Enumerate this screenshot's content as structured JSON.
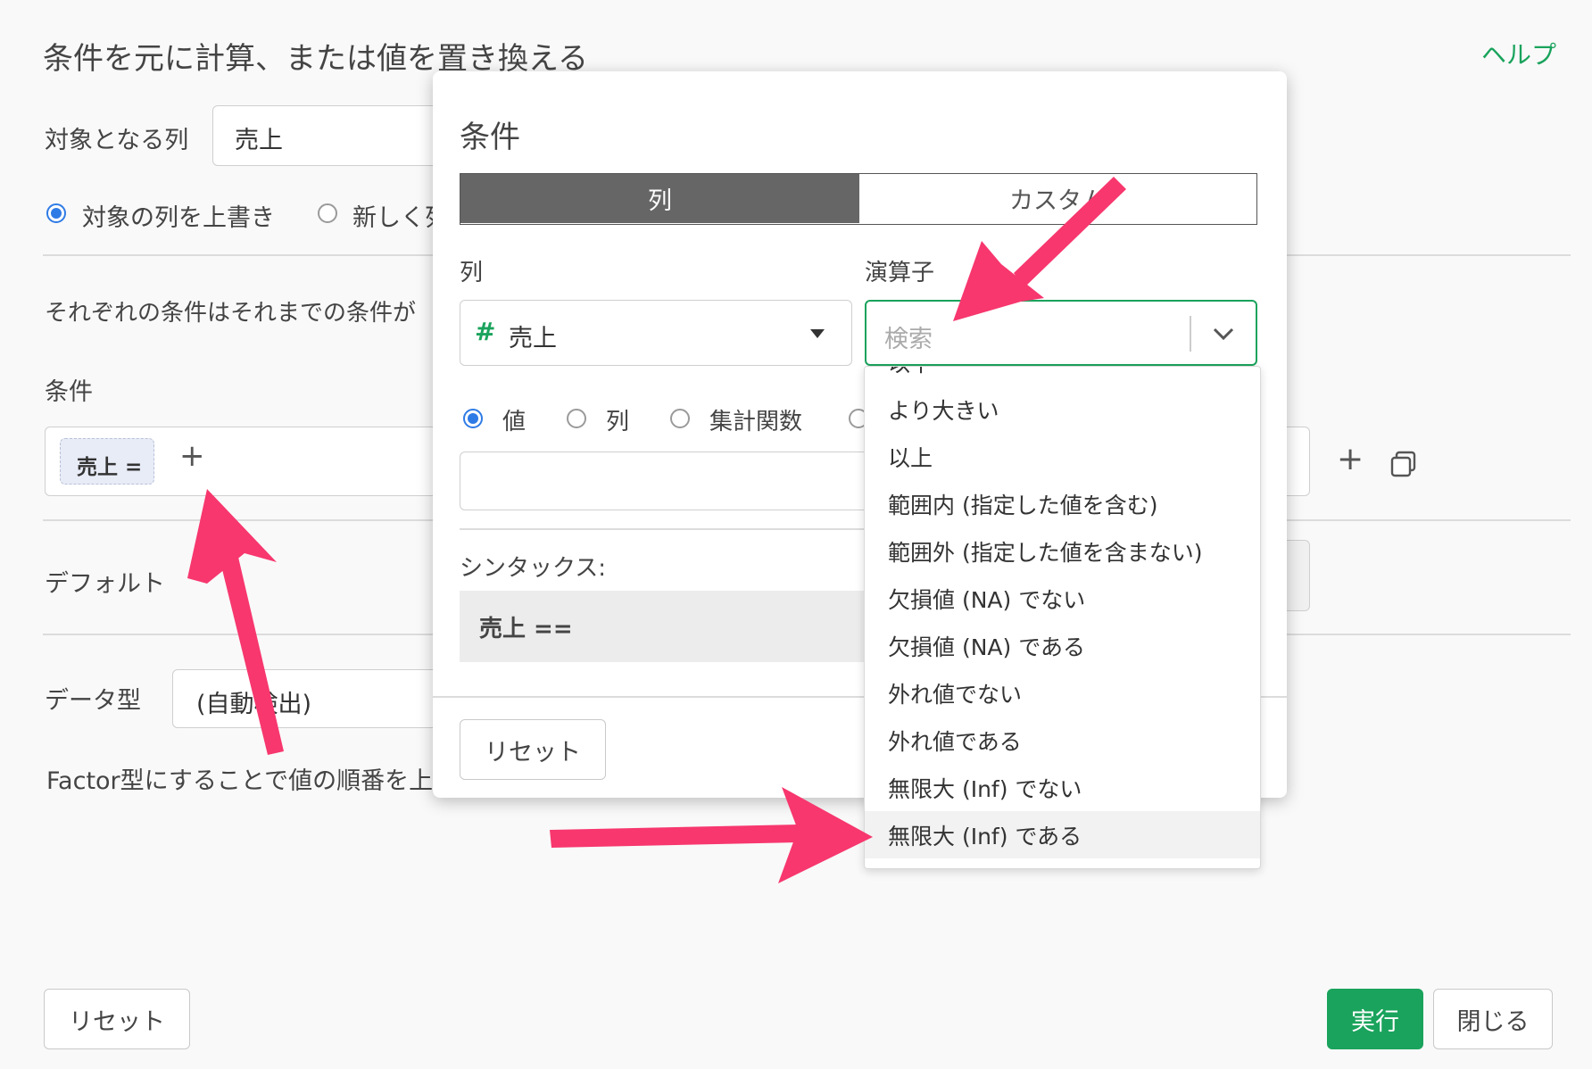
{
  "page": {
    "title": "条件を元に計算、または値を置き換える",
    "help": "ヘルプ",
    "target_label": "対象となる列",
    "target_value": "売上",
    "radio_overwrite": "対象の列を上書き",
    "radio_new": "新しく列",
    "description": "それぞれの条件はそれまでの条件が",
    "condition_label": "条件",
    "condition_chip": "売上 =",
    "default_label": "デフォルト",
    "datatype_label": "データ型",
    "datatype_value": "(自動検出)",
    "factor_note": "Factor型にすることで値の順番を上",
    "reset_button": "リセット",
    "run_button": "実行",
    "close_button": "閉じる"
  },
  "modal": {
    "title": "条件",
    "tabs": [
      {
        "label": "列",
        "active": true
      },
      {
        "label": "カスタム",
        "active": false
      }
    ],
    "column_label": "列",
    "column_type_icon": "#",
    "column_value": "売上",
    "operator_label": "演算子",
    "operator_placeholder": "検索",
    "value_type_options": [
      "値",
      "列",
      "集計関数"
    ],
    "syntax_label": "シンタックス:",
    "syntax_value": "売上 ==",
    "reset_button": "リセット"
  },
  "dropdown": {
    "partial_item": "以下",
    "items": [
      "より大きい",
      "以上",
      "範囲内 (指定した値を含む)",
      "範囲外 (指定した値を含まない)",
      "欠損値 (NA) でない",
      "欠損値 (NA) である",
      "外れ値でない",
      "外れ値である",
      "無限大 (Inf) でない",
      "無限大 (Inf) である"
    ],
    "highlighted": "無限大 (Inf) である"
  },
  "colors": {
    "accent_green": "#1aa35c",
    "radio_blue": "#2f7be6",
    "active_tab": "#666666",
    "annotation_arrow": "#f7376e",
    "chip_bg": "#e8ecf7"
  }
}
